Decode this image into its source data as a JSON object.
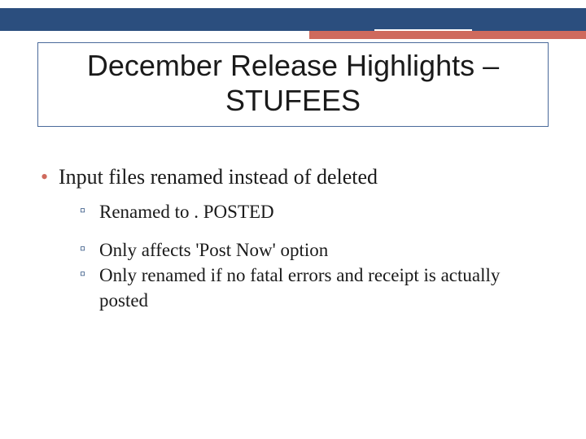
{
  "title": {
    "line1": "December Release Highlights –",
    "line2": "STUFEES"
  },
  "bullets": {
    "level1": [
      "Input files renamed instead of deleted"
    ],
    "level2": [
      "Renamed to . POSTED",
      "Only affects 'Post Now' option",
      "Only renamed if no fatal errors and receipt is actually posted"
    ]
  },
  "colors": {
    "band_blue": "#2b4e7e",
    "band_red": "#cf6a5d",
    "title_border": "#4a6a9a",
    "bullet1": "#cf6a5d",
    "bullet2": "#2b4e7e"
  }
}
